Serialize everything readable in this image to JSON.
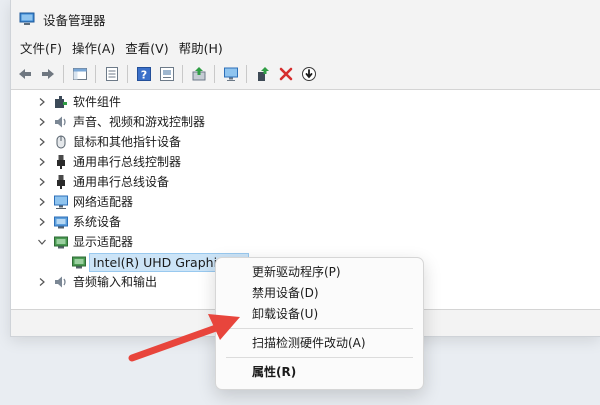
{
  "window": {
    "title": "设备管理器"
  },
  "menu": [
    {
      "label": "文件(F)"
    },
    {
      "label": "操作(A)"
    },
    {
      "label": "查看(V)"
    },
    {
      "label": "帮助(H)"
    }
  ],
  "toolbar": {
    "buttons": [
      {
        "name": "back-icon"
      },
      {
        "name": "forward-icon"
      },
      {
        "name": "show-hide-tree-icon"
      },
      {
        "name": "properties-sheet-icon"
      },
      {
        "name": "help-icon"
      },
      {
        "name": "device-view-icon"
      },
      {
        "name": "update-driver-icon"
      },
      {
        "name": "scan-hardware-icon"
      },
      {
        "name": "add-driver-icon"
      },
      {
        "name": "uninstall-icon"
      },
      {
        "name": "download-icon"
      }
    ]
  },
  "tree": {
    "items": [
      {
        "label": "软件组件",
        "icon": "puzzle-icon"
      },
      {
        "label": "声音、视频和游戏控制器",
        "icon": "speaker-icon"
      },
      {
        "label": "鼠标和其他指针设备",
        "icon": "mouse-icon"
      },
      {
        "label": "通用串行总线控制器",
        "icon": "usb-icon"
      },
      {
        "label": "通用串行总线设备",
        "icon": "usb-icon"
      },
      {
        "label": "网络适配器",
        "icon": "monitor-network-icon"
      },
      {
        "label": "系统设备",
        "icon": "system-device-icon"
      },
      {
        "label": "显示适配器",
        "icon": "display-adapter-icon",
        "expanded": true
      },
      {
        "label": "音频输入和输出",
        "icon": "speaker-icon"
      }
    ],
    "child": {
      "label": "Intel(R) UHD Graphics 630"
    }
  },
  "context_menu": {
    "items": [
      {
        "label": "更新驱动程序(P)"
      },
      {
        "label": "禁用设备(D)"
      },
      {
        "label": "卸载设备(U)"
      },
      {
        "label": "扫描检测硬件改动(A)"
      },
      {
        "label": "属性(R)"
      }
    ]
  },
  "colors": {
    "selection": "#cce4f7",
    "arrow": "#e8453c",
    "accent": "#2b7fd6"
  }
}
